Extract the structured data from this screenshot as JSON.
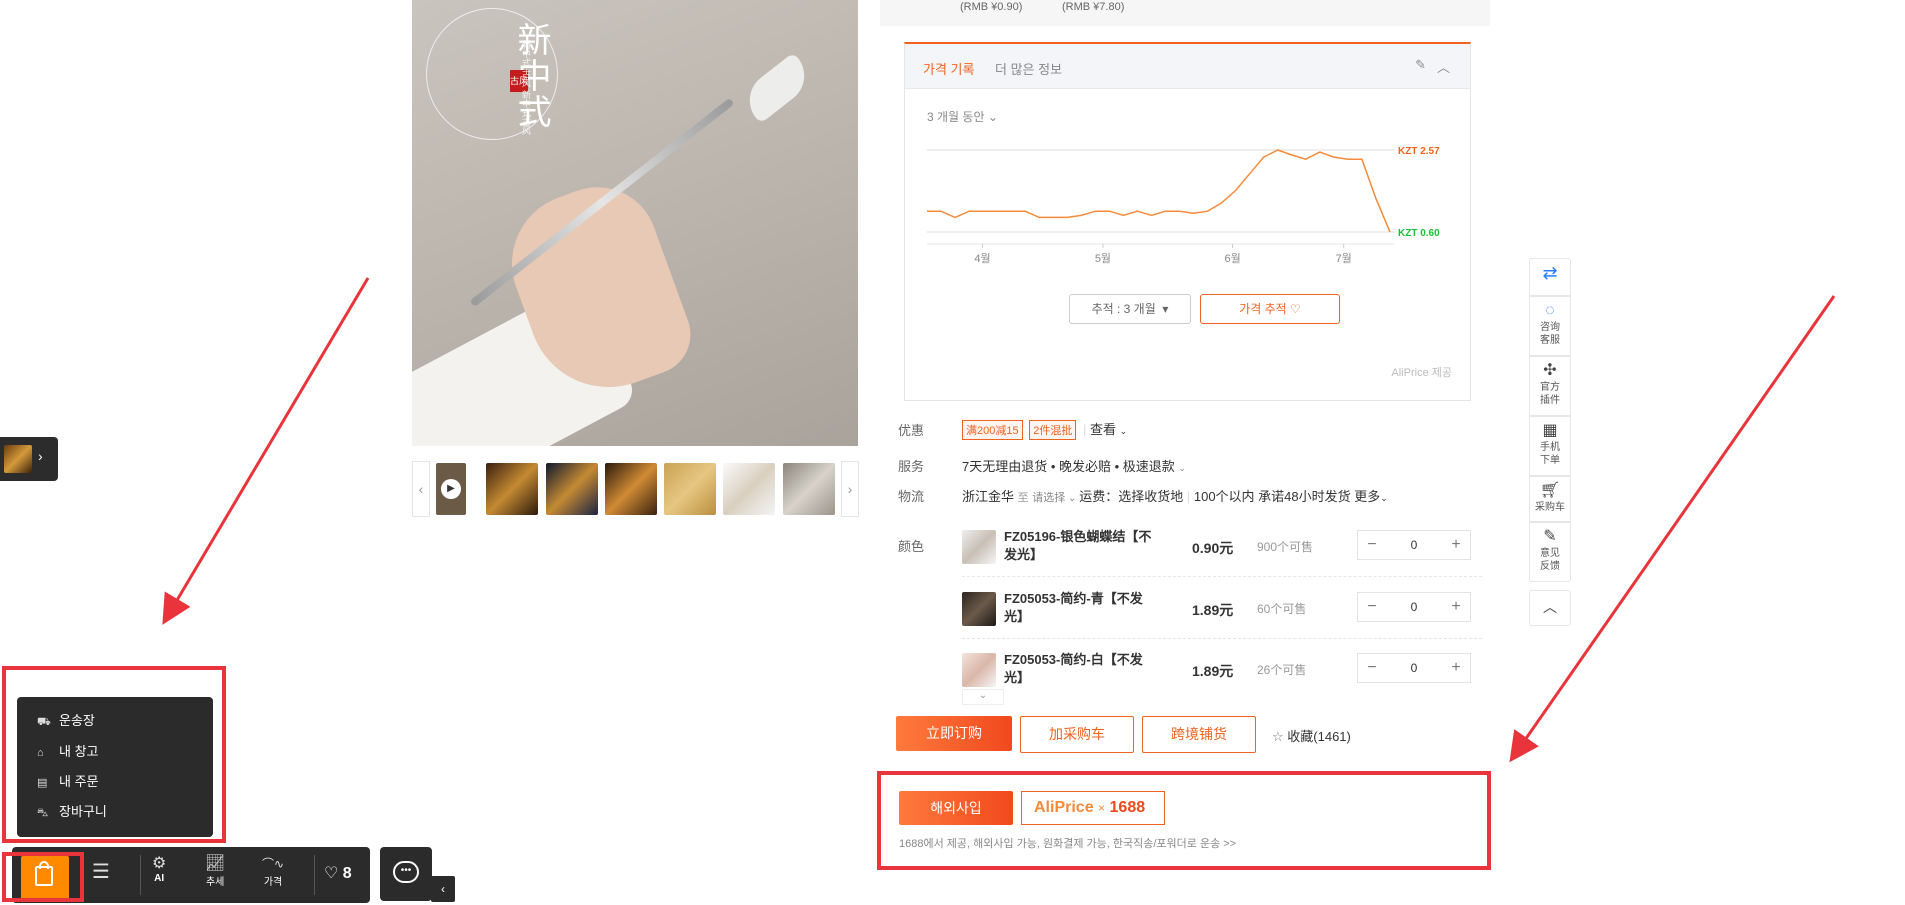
{
  "top_prices": [
    "(RMB ¥0.90)",
    "(RMB ¥7.80)"
  ],
  "price_card": {
    "tab_active": "가격 기록",
    "tab_more": "더 많은 정보",
    "edit_icon": "pencil-icon",
    "collapse_icon": "chevron-up-icon",
    "period": "3 개월 동안",
    "period_button": "추적 : 3 개월",
    "track_button": "가격 추적",
    "footer": "AliPrice 제공",
    "chart_data": {
      "type": "line",
      "x_tick_labels": [
        "4월",
        "5월",
        "6월",
        "7월"
      ],
      "max_label": "KZT 2.57",
      "min_label": "KZT 0.60",
      "series": [
        {
          "values": [
            1.1,
            1.1,
            0.95,
            1.1,
            1.1,
            1.1,
            1.1,
            1.1,
            0.95,
            0.95,
            0.95,
            1.0,
            1.1,
            1.1,
            1.0,
            1.1,
            1.0,
            1.1,
            1.1,
            1.05,
            1.1,
            1.3,
            1.6,
            2.0,
            2.4,
            2.57,
            2.45,
            2.35,
            2.52,
            2.4,
            2.35,
            2.35,
            1.4,
            0.6
          ]
        }
      ],
      "colors": {
        "line": "#f58a3a",
        "max": "#f0631e",
        "min": "#1dbf3a"
      }
    }
  },
  "info": {
    "discount_label": "优惠",
    "discount_tags": [
      "满200减15",
      "2件混批"
    ],
    "discount_view": "查看",
    "service_label": "服务",
    "service_text": "7天无理由退货 • 晚发必赔 • 极速退款",
    "logistics_label": "物流",
    "logistics_from": "浙江金华",
    "logistics_to_prefix": "至",
    "logistics_to": "请选择",
    "shipping_fee": "运费：选择收货地",
    "delivery_promise": "100个以内 承诺48小时发货",
    "more": "更多",
    "color_label": "颜色"
  },
  "skus": [
    {
      "name": "FZ05196-银色蝴蝶结【不发光】",
      "price": "0.90元",
      "stock": "900个可售",
      "qty": "0"
    },
    {
      "name": "FZ05053-简约-青【不发光】",
      "price": "1.89元",
      "stock": "60个可售",
      "qty": "0"
    },
    {
      "name": "FZ05053-简约-白【不发光】",
      "price": "1.89元",
      "stock": "26个可售",
      "qty": "0"
    }
  ],
  "actions": {
    "buy_now": "立即订购",
    "add_cart": "加采购车",
    "cross_border": "跨境铺货",
    "favorite": "收藏(1461)"
  },
  "aliprice": {
    "button": "해외사입",
    "logo_brand": "AliPrice",
    "logo_x": "×",
    "logo_partner": "1688",
    "note": "1688에서 제공, 해외사입 가능, 원화결제 가능, 한국직송/포워더로 운송 >>"
  },
  "right_toolbar": [
    {
      "icon": "translate-icon",
      "label": ""
    },
    {
      "icon": "chat-bubble-icon",
      "label": "咨询客服"
    },
    {
      "icon": "puzzle-icon",
      "label": "官方插件"
    },
    {
      "icon": "qr-code-icon",
      "label": "手机下单"
    },
    {
      "icon": "cart-icon",
      "label": "采购车"
    },
    {
      "icon": "edit-icon",
      "label": "意见反馈"
    },
    {
      "icon": "chevron-up-icon",
      "label": ""
    }
  ],
  "popup_menu": [
    "운송장",
    "내 창고",
    "내 주문",
    "장바구니"
  ],
  "bottom_bar": {
    "ai": "AI",
    "trend": "추세",
    "price": "가격",
    "likes": "8"
  },
  "colors": {
    "accent": "#f0631e",
    "highlight": "#e8343a",
    "dark_panel": "#2b2b2b"
  }
}
